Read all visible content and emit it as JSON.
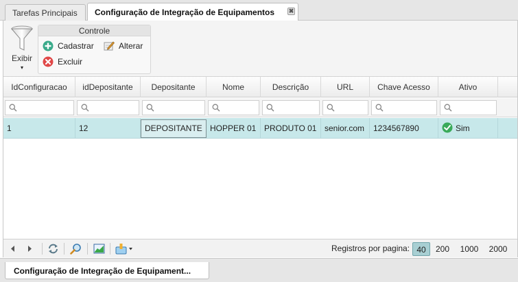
{
  "tabs": {
    "main": "Tarefas Principais",
    "active": "Configuração de Integração de Equipamentos",
    "close_glyph": "✖"
  },
  "toolbar": {
    "exibir_label": "Exibir",
    "exibir_arrow": "▾",
    "group_title": "Controle",
    "cadastrar": "Cadastrar",
    "alterar": "Alterar",
    "excluir": "Excluir"
  },
  "grid": {
    "columns": [
      "IdConfiguracao",
      "idDepositante",
      "Depositante",
      "Nome",
      "Descrição",
      "URL",
      "Chave Acesso",
      "Ativo"
    ],
    "row": [
      "1",
      "12",
      "DEPOSITANTE",
      "HOPPER 01",
      "PRODUTO 01",
      "senior.com",
      "1234567890",
      "Sim"
    ]
  },
  "paging": {
    "label": "Registros por pagina:",
    "sizes": [
      "40",
      "200",
      "1000",
      "2000"
    ],
    "active": "40"
  },
  "bottom_tab": "Configuração de Integração de Equipament...",
  "colors": {
    "selected_row": "#c7e8ea",
    "accent_green": "#3aaa6a",
    "accent_red": "#e04848"
  },
  "icons": [
    "filter-icon",
    "add-icon",
    "edit-icon",
    "delete-icon",
    "search-icon",
    "check-icon",
    "prev-icon",
    "next-icon",
    "refresh-icon",
    "zoom-icon",
    "chart-icon",
    "export-icon"
  ]
}
